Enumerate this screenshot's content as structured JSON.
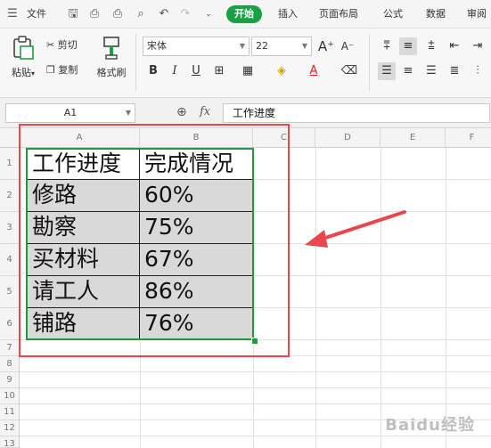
{
  "menu": {
    "file_label": "文件",
    "tabs": [
      "开始",
      "插入",
      "页面布局",
      "公式",
      "数据",
      "审阅"
    ]
  },
  "ribbon": {
    "paste_label": "粘贴",
    "cut_label": "剪切",
    "copy_label": "复制",
    "format_painter_label": "格式刷",
    "font_name": "宋体",
    "font_size": "22",
    "bold": "B",
    "italic": "I",
    "underline": "U",
    "font_color_letter": "A",
    "grow_font": "A⁺",
    "shrink_font": "A⁻"
  },
  "formula_bar": {
    "cell_ref": "A1",
    "fx_label": "fx",
    "content": "工作进度"
  },
  "grid": {
    "columns": [
      "A",
      "B",
      "C",
      "D",
      "E",
      "F"
    ],
    "rows": [
      "1",
      "2",
      "3",
      "4",
      "5",
      "6",
      "7",
      "8",
      "9",
      "10",
      "11",
      "12",
      "13"
    ],
    "table": [
      [
        "工作进度",
        "完成情况"
      ],
      [
        "修路",
        "60%"
      ],
      [
        "勘察",
        "75%"
      ],
      [
        "买材料",
        "67%"
      ],
      [
        "请工人",
        "86%"
      ],
      [
        "铺路",
        "76%"
      ]
    ]
  },
  "colors": {
    "accent_green": "#1aa045",
    "selection_green": "#1f9a3d",
    "annotation_red": "#e8484d"
  },
  "watermark": "Baidu经验"
}
